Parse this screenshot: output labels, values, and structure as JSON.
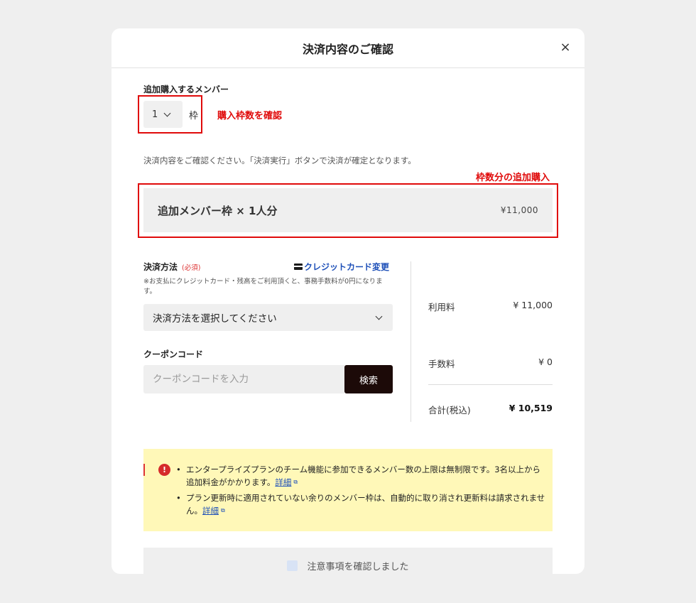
{
  "modal": {
    "title": "決済内容のご確認",
    "close": "×"
  },
  "members": {
    "label": "追加購入するメンバー",
    "quantity": "1",
    "unit": "枠",
    "annotation": "購入枠数を確認"
  },
  "confirm_text": "決済内容をご確認ください。「決済実行」ボタンで決済が確定となります。",
  "summary": {
    "annotation": "枠数分の追加購入",
    "title": "追加メンバー枠 × 1人分",
    "price": "¥11,000"
  },
  "payment": {
    "label": "決済方法",
    "required": "(必須)",
    "card_change": "クレジットカード変更",
    "note": "※お支払にクレジットカード・残高をご利用頂くと、事務手数料が0円になります。",
    "select_placeholder": "決済方法を選択してください"
  },
  "coupon": {
    "label": "クーポンコード",
    "placeholder": "クーポンコードを入力",
    "button": "検索"
  },
  "fees": {
    "usage_label": "利用料",
    "usage_value": "¥ 11,000",
    "handling_label": "手数料",
    "handling_value": "¥ 0",
    "total_label": "合計(税込)",
    "total_value": "¥ 10,519"
  },
  "notice": {
    "icon": "!",
    "item1": "エンタープライズプランのチーム機能に参加できるメンバー数の上限は無制限です。3名以上から追加料金がかかります。",
    "item2": "プラン更新時に適用されていない余りのメンバー枠は、自動的に取り消され更新料は請求されません。",
    "link_label": "詳細",
    "ext": "⧉"
  },
  "agree": {
    "label": "注意事項を確認しました"
  },
  "colors": {
    "annotation_red": "#e00a0a",
    "link_blue": "#1d4fb8",
    "dark_button": "#1c0a08",
    "notice_bg": "#fff8b8"
  }
}
